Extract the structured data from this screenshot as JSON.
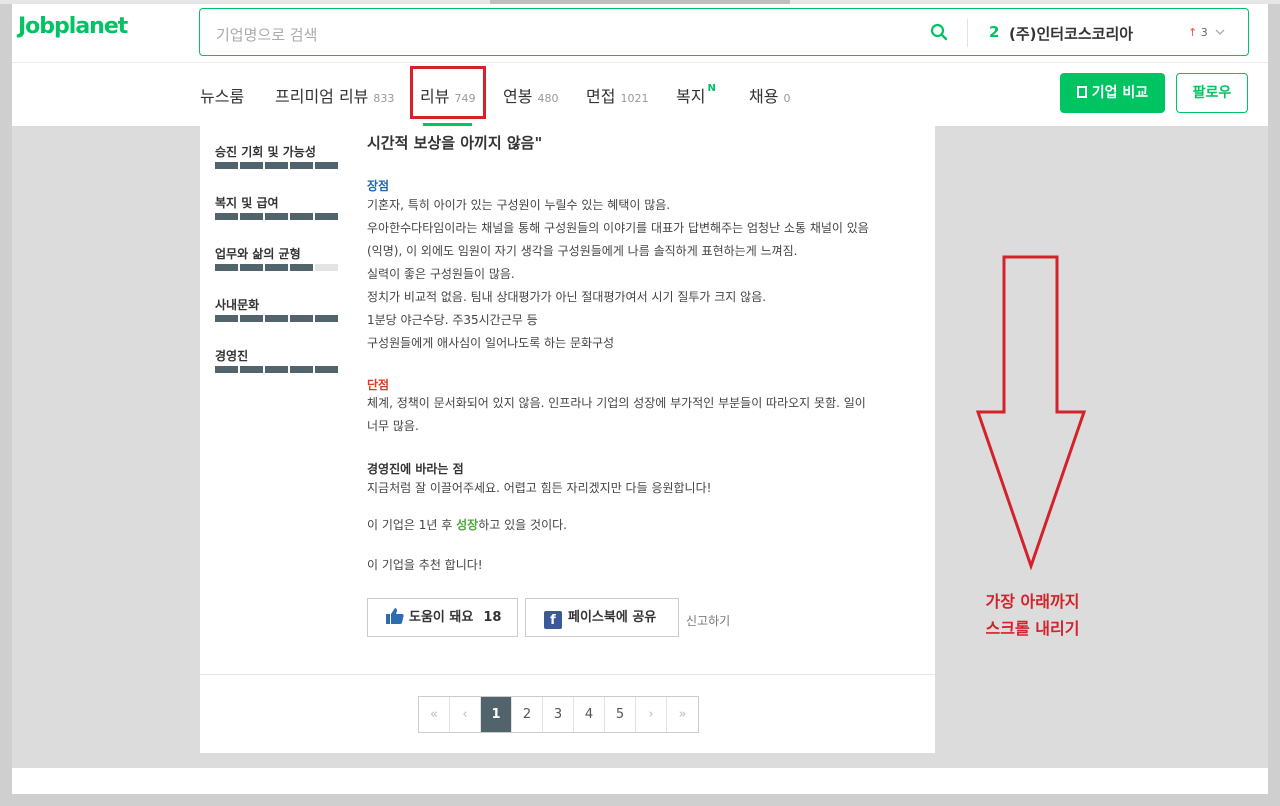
{
  "header": {
    "logo": "Jobplanet",
    "search": {
      "placeholder": "기업명으로 검색",
      "rank_num": "2",
      "rank_name": "(주)인터코스코리아",
      "rank_change_arrow": "↑",
      "rank_change": "3"
    },
    "nav": [
      {
        "label": "뉴스룸",
        "count": ""
      },
      {
        "label": "프리미엄 리뷰",
        "count": "833"
      },
      {
        "label": "리뷰",
        "count": "749"
      },
      {
        "label": "연봉",
        "count": "480"
      },
      {
        "label": "면접",
        "count": "1021"
      },
      {
        "label": "복지",
        "count": "",
        "badge": "N"
      },
      {
        "label": "채용",
        "count": "0"
      }
    ],
    "compare_button": "기업 비교",
    "follow_button": "팔로우"
  },
  "ratings": [
    {
      "label": "승진 기회 및 가능성",
      "score": 5
    },
    {
      "label": "복지 및 급여",
      "score": 5
    },
    {
      "label": "업무와 삶의 균형",
      "score": 4
    },
    {
      "label": "사내문화",
      "score": 5
    },
    {
      "label": "경영진",
      "score": 5
    }
  ],
  "review": {
    "title": "시간적 보상을 아끼지 않음\"",
    "pros_head": "장점",
    "pros": [
      "기혼자, 특히 아이가 있는 구성원이 누릴수 있는 혜택이 많음.",
      "우아한수다타임이라는 채널을 통해 구성원들의 이야기를 대표가 답변해주는 엄청난 소통 채널이 있음",
      "(익명), 이 외에도 임원이 자기 생각을 구성원들에게 나름 솔직하게 표현하는게 느껴짐.",
      "실력이 좋은 구성원들이 많음.",
      "정치가 비교적 없음. 팀내 상대평가가 아닌 절대평가여서 시기 질투가 크지 않음.",
      "1분당 야근수당. 주35시간근무 등",
      "구성원들에게 애사심이 일어나도록 하는 문화구성"
    ],
    "cons_head": "단점",
    "cons": [
      "체계, 정책이 문서화되어 있지 않음. 인프라나 기업의 성장에 부가적인 부분들이 따라오지 못함. 일이",
      "너무 많음."
    ],
    "ceo_head": "경영진에 바라는 점",
    "ceo": [
      "지금처럼 잘 이끌어주세요. 어렵고 힘든 자리겠지만 다들 응원합니다!"
    ],
    "prediction_pre": "이 기업은 1년 후 ",
    "prediction_key": "성장",
    "prediction_post": "하고 있을 것이다.",
    "recommend": "이 기업을 추천 합니다!",
    "helpful_label": "도움이 돼요",
    "helpful_count": "18",
    "facebook_label": "페이스북에 공유",
    "report_label": "신고하기"
  },
  "pagination": {
    "first": "«",
    "prev": "‹",
    "pages": [
      "1",
      "2",
      "3",
      "4",
      "5"
    ],
    "active": "1",
    "next": "›",
    "last": "»"
  },
  "annotation": {
    "line1": "가장 아래까지",
    "line2": "스크롤 내리기",
    "color": "#d3222a"
  },
  "colors": {
    "brand": "#00c362",
    "bar": "#51646c",
    "pros": "#2369a7",
    "cons": "#d3401f"
  }
}
